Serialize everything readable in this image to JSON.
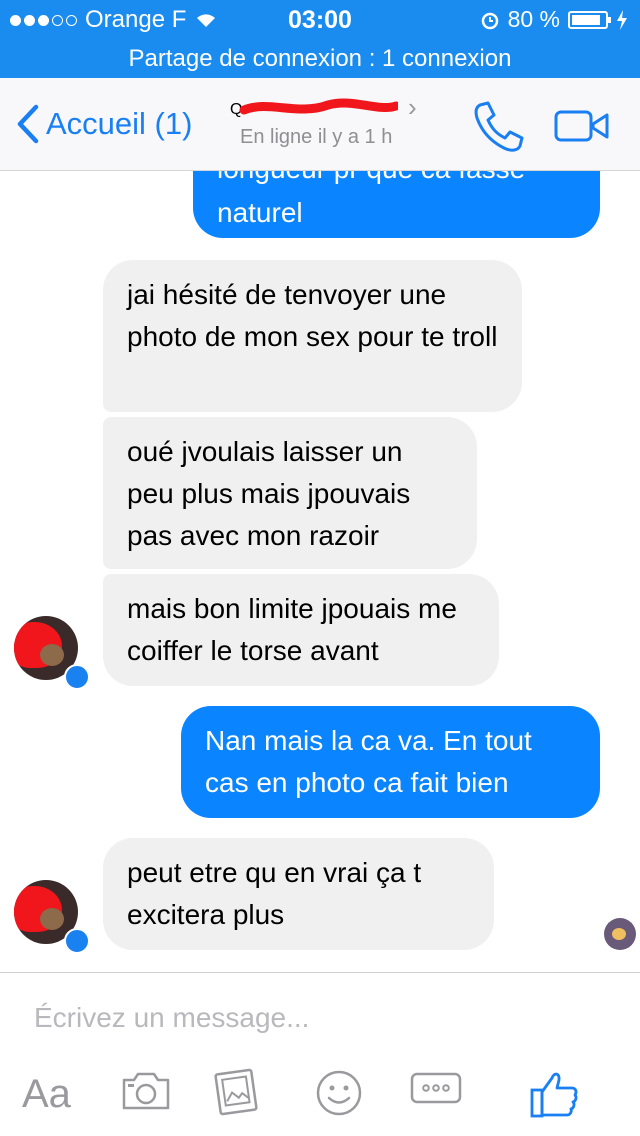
{
  "status_bar": {
    "carrier": "Orange F",
    "time": "03:00",
    "battery": "80 %"
  },
  "hotspot_banner": "Partage de connexion : 1 connexion",
  "nav": {
    "back_label": "Accueil (1)",
    "presence": "En ligne il y a 1 h"
  },
  "messages": [
    {
      "direction": "out",
      "text": "longueur pr que ca fasse naturel"
    },
    {
      "direction": "in",
      "text": "jai hésité de tenvoyer une photo de mon sex pour te troll"
    },
    {
      "direction": "in",
      "text": "oué jvoulais laisser un peu plus mais jpouvais pas avec mon razoir"
    },
    {
      "direction": "in",
      "text": "mais bon limite jpouais me coiffer le torse avant"
    },
    {
      "direction": "out",
      "text": "Nan mais la ca va. En tout cas en photo ca fait bien"
    },
    {
      "direction": "in",
      "text": "peut etre qu en vrai ça t excitera plus"
    }
  ],
  "composer": {
    "placeholder": "Écrivez un message..."
  },
  "toolbar": {
    "text_tool_label": "Aa"
  },
  "colors": {
    "accent": "#1a8cf0",
    "outgoing_bubble": "#0a84ff",
    "incoming_bubble": "#f1f0f0",
    "redaction": "#f0161b"
  },
  "icons": [
    "wifi-icon",
    "alarm-icon",
    "battery-icon",
    "charging-icon",
    "back-chevron-icon",
    "phone-icon",
    "video-camera-icon",
    "camera-icon",
    "image-icon",
    "emoji-icon",
    "more-icon",
    "like-icon",
    "messenger-badge-icon"
  ]
}
